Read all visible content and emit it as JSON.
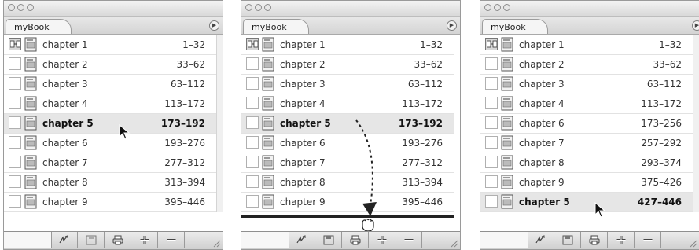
{
  "panels": [
    {
      "tab_label": "myBook",
      "rows": [
        {
          "name": "chapter 1",
          "pages": "1–32"
        },
        {
          "name": "chapter 2",
          "pages": "33–62"
        },
        {
          "name": "chapter 3",
          "pages": "63–112"
        },
        {
          "name": "chapter 4",
          "pages": "113–172"
        },
        {
          "name": "chapter 5",
          "pages": "173–192"
        },
        {
          "name": "chapter 6",
          "pages": "193–276"
        },
        {
          "name": "chapter 7",
          "pages": "277–312"
        },
        {
          "name": "chapter 8",
          "pages": "313–394"
        },
        {
          "name": "chapter 9",
          "pages": "395–446"
        }
      ]
    },
    {
      "tab_label": "myBook",
      "rows": [
        {
          "name": "chapter 1",
          "pages": "1–32"
        },
        {
          "name": "chapter 2",
          "pages": "33–62"
        },
        {
          "name": "chapter 3",
          "pages": "63–112"
        },
        {
          "name": "chapter 4",
          "pages": "113–172"
        },
        {
          "name": "chapter 5",
          "pages": "173–192"
        },
        {
          "name": "chapter 6",
          "pages": "193–276"
        },
        {
          "name": "chapter 7",
          "pages": "277–312"
        },
        {
          "name": "chapter 8",
          "pages": "313–394"
        },
        {
          "name": "chapter 9",
          "pages": "395–446"
        }
      ]
    },
    {
      "tab_label": "myBook",
      "rows": [
        {
          "name": "chapter 1",
          "pages": "1–32"
        },
        {
          "name": "chapter 2",
          "pages": "33–62"
        },
        {
          "name": "chapter 3",
          "pages": "63–112"
        },
        {
          "name": "chapter 4",
          "pages": "113–172"
        },
        {
          "name": "chapter 6",
          "pages": "173–256"
        },
        {
          "name": "chapter 7",
          "pages": "257–292"
        },
        {
          "name": "chapter 8",
          "pages": "293–374"
        },
        {
          "name": "chapter 9",
          "pages": "375–426"
        },
        {
          "name": "chapter 5",
          "pages": "427–446"
        }
      ]
    }
  ],
  "colors": {
    "selected_row": "#e6e6e6",
    "drop_indicator": "#222222"
  },
  "icons": {
    "style_source": "sync-icon",
    "document": "indesign-document-icon",
    "bottom_buttons": [
      "synchronize-icon",
      "save-book-icon",
      "print-book-icon",
      "add-document-icon",
      "remove-document-icon"
    ]
  }
}
